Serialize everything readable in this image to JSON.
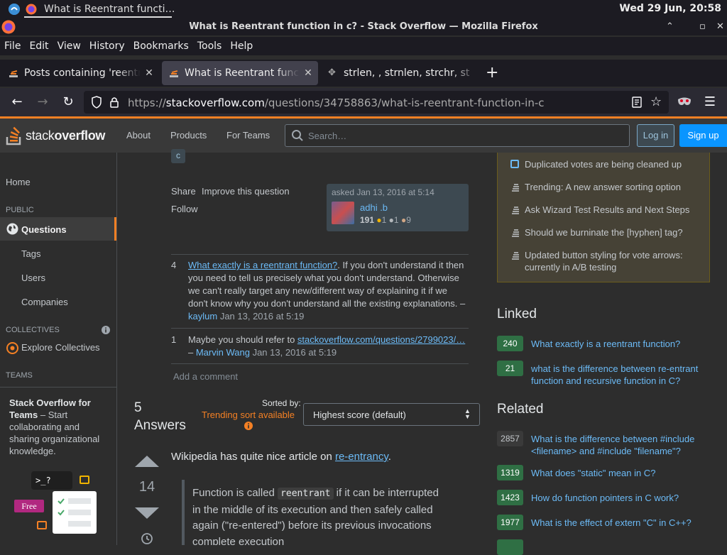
{
  "system": {
    "active_window_title": "What is Reentrant functi…",
    "clock": "Wed 29 Jun, 20:58"
  },
  "window": {
    "title": "What is Reentrant function in c? - Stack Overflow — Mozilla Firefox"
  },
  "menu": [
    "File",
    "Edit",
    "View",
    "History",
    "Bookmarks",
    "Tools",
    "Help"
  ],
  "tabs": [
    {
      "label": "Posts containing 'reentra",
      "active": false
    },
    {
      "label": "What is Reentrant functio",
      "active": true
    },
    {
      "label": "strlen, , strnlen, strchr, st",
      "active": false
    }
  ],
  "url": {
    "prefix": "https://",
    "domain": "stackoverflow.com",
    "path": "/questions/34758863/what-is-reentrant-function-in-c"
  },
  "so_header": {
    "logo_text_plain": "stack",
    "logo_text_bold": "overflow",
    "nav": [
      "About",
      "Products",
      "For Teams"
    ],
    "search_placeholder": "Search…",
    "login": "Log in",
    "signup": "Sign up"
  },
  "left_nav": {
    "home": "Home",
    "public_label": "PUBLIC",
    "questions": "Questions",
    "tags": "Tags",
    "users": "Users",
    "companies": "Companies",
    "collectives_label": "COLLECTIVES",
    "explore_collectives": "Explore Collectives",
    "teams_label": "TEAMS",
    "teams_promo_title": "Stack Overflow for Teams",
    "teams_promo_text": " – Start collaborating and sharing organizational knowledge.",
    "free_badge": "Free",
    "terminal_glyph": ">_?"
  },
  "question": {
    "tag": "c",
    "share": "Share",
    "improve": "Improve this question",
    "follow": "Follow",
    "asked": "asked Jan 13, 2016 at 5:14",
    "user_name": "adhi .b",
    "reputation": "191",
    "gold": "1",
    "silver": "1",
    "bronze": "9"
  },
  "comments": [
    {
      "score": "4",
      "link_text": "What exactly is a reentrant function?",
      "text": ". If you don't understand it then you need to tell us precisely what you don't understand. Otherwise we can't really target any new/different way of explaining it if we don't know why you don't understand all the existing explanations.",
      "dash": " – ",
      "user": "kaylum",
      "date": "Jan 13, 2016 at 5:19"
    },
    {
      "score": "1",
      "text_before": "Maybe you should refer to ",
      "link_text": "stackoverflow.com/questions/2799023/…",
      "dash": " – ",
      "user": "Marvin Wang",
      "date": "Jan 13, 2016 at 5:19"
    }
  ],
  "add_comment": "Add a comment",
  "answers": {
    "count": "5",
    "label": "Answers",
    "sorted_by": "Sorted by:",
    "trending": "Trending sort available",
    "sort_value": "Highest score (default)"
  },
  "answer": {
    "score": "14",
    "intro_text": "Wikipedia has quite nice article on ",
    "intro_link": "re-entrancy",
    "intro_end": ".",
    "quote_before": "Function is called ",
    "quote_code": "reentrant",
    "quote_after": " if it can be interrupted in the middle of its execution and then safely called again (\"re-entered\") before its previous invocations complete execution"
  },
  "meta_posts": [
    {
      "icon": "chat-bubble-icon",
      "text": "Duplicated votes are being cleaned up"
    },
    {
      "icon": "stack-icon",
      "text": "Trending: A new answer sorting option"
    },
    {
      "icon": "stack-icon",
      "text": "Ask Wizard Test Results and Next Steps"
    },
    {
      "icon": "stack-icon",
      "text": "Should we burninate the [hyphen] tag?"
    },
    {
      "icon": "stack-icon",
      "text": "Updated button styling for vote arrows: currently in A/B testing"
    }
  ],
  "linked": {
    "title": "Linked",
    "items": [
      {
        "score": "240",
        "text": "What exactly is a reentrant function?"
      },
      {
        "score": "21",
        "text": "what is the difference between re-entrant function and recursive function in C?"
      }
    ]
  },
  "related": {
    "title": "Related",
    "items": [
      {
        "score": "2857",
        "text": "What is the difference between #include <filename> and #include \"filename\"?",
        "accepted": false
      },
      {
        "score": "1319",
        "text": "What does \"static\" mean in C?",
        "accepted": true
      },
      {
        "score": "1423",
        "text": "How do function pointers in C work?",
        "accepted": true
      },
      {
        "score": "1977",
        "text": "What is the effect of extern \"C\" in C++?",
        "accepted": true
      }
    ]
  },
  "colors": {
    "so_orange": "#f48024",
    "link_blue": "#6cbbf7",
    "signup_blue": "#0a95ff",
    "accepted_green": "#2f6f44"
  }
}
